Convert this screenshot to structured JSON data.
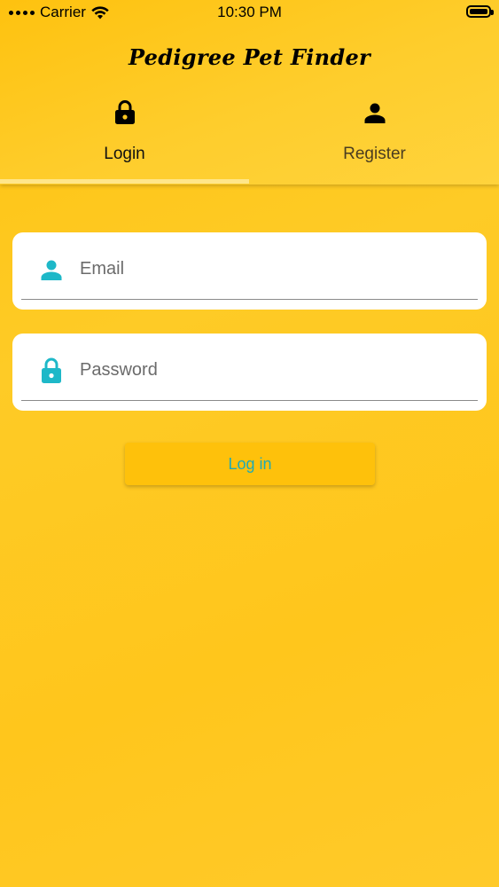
{
  "status_bar": {
    "carrier": "Carrier",
    "time": "10:30 PM",
    "battery_level": 1.0
  },
  "app": {
    "title": "Pedigree Pet Finder"
  },
  "tabs": [
    {
      "label": "Login",
      "icon": "lock-icon",
      "selected": true
    },
    {
      "label": "Register",
      "icon": "person-icon",
      "selected": false
    }
  ],
  "form": {
    "email": {
      "placeholder": "Email",
      "value": "",
      "icon": "person-icon"
    },
    "password": {
      "placeholder": "Password",
      "value": "",
      "icon": "lock-icon"
    },
    "submit_label": "Log in"
  },
  "colors": {
    "background": "#fec20f",
    "icon_accent": "#1eb8c8",
    "button_text": "#1eaab5",
    "button_bg": "#fec10b",
    "tab_indicator": "#ffe68a"
  }
}
